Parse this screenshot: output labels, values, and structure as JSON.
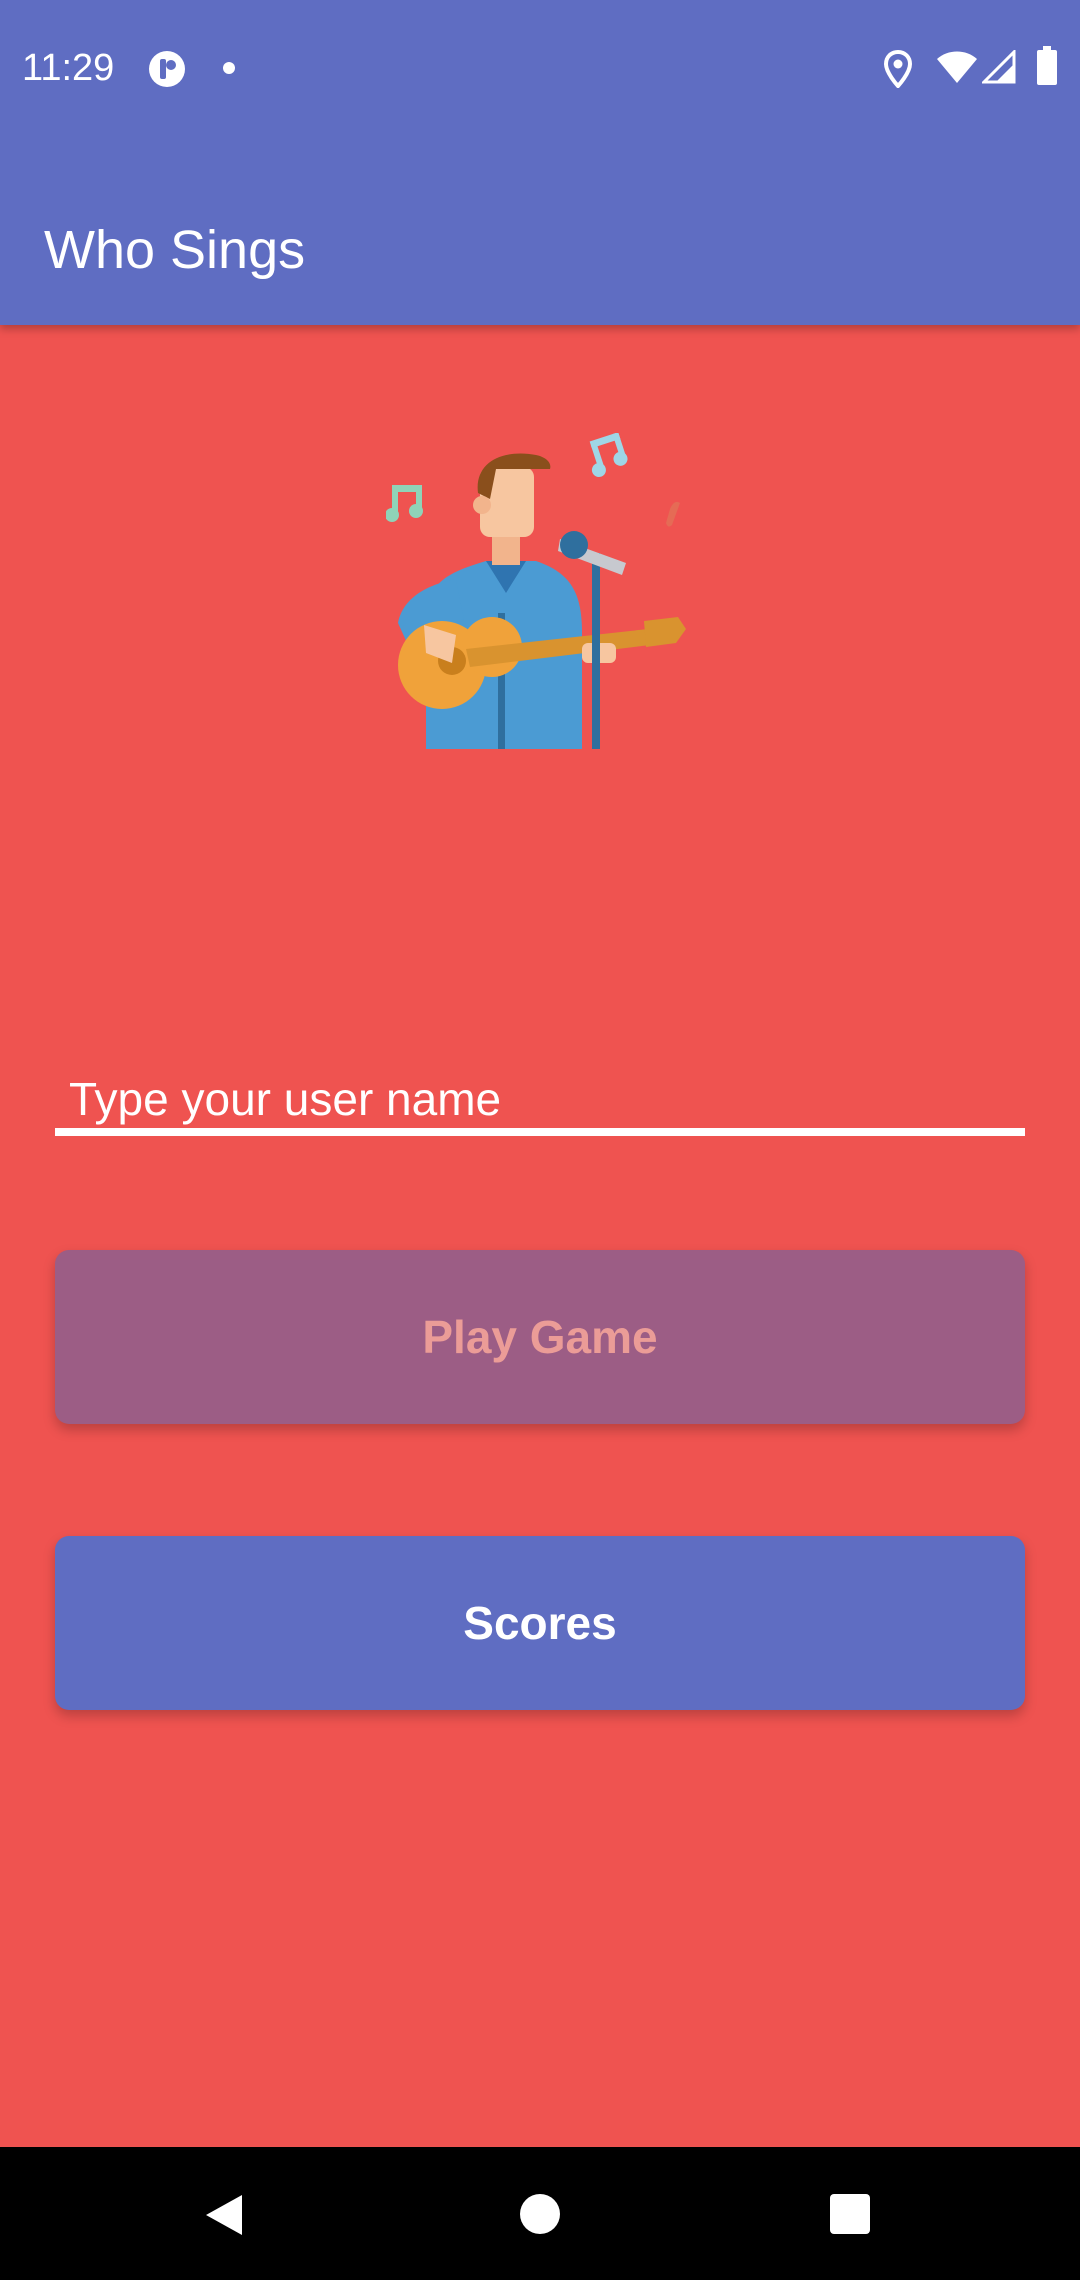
{
  "status_bar": {
    "time": "11:29",
    "icons": [
      "app-notification-icon",
      "dot-icon",
      "location-icon",
      "wifi-icon",
      "cell-signal-icon",
      "battery-icon"
    ]
  },
  "app_bar": {
    "title": "Who Sings"
  },
  "main": {
    "illustration": "singer-guitar-illustration",
    "username_field": {
      "value": "",
      "placeholder": "Type your user name"
    },
    "play_button_label": "Play Game",
    "scores_button_label": "Scores"
  },
  "nav_bar": {
    "icons": [
      "back-icon",
      "home-icon",
      "recents-icon"
    ]
  },
  "colors": {
    "primary": "#5f6dc2",
    "background": "#ef5350",
    "play_button_disabled": "#9c5d85",
    "play_button_text": "#eb9c97"
  }
}
